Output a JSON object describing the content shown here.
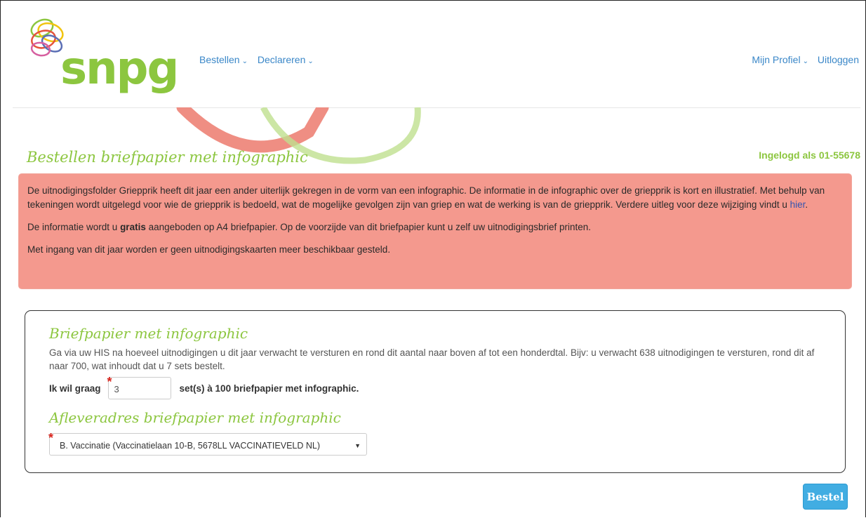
{
  "brand": {
    "name": "snpg",
    "colors": {
      "accent": "#8cc63f",
      "alert": "#f4998e",
      "link": "#3a87c8",
      "button": "#41ade2"
    }
  },
  "nav": {
    "left": [
      {
        "label": "Bestellen",
        "icon": "chevron-down-icon"
      },
      {
        "label": "Declareren",
        "icon": "chevron-down-icon"
      }
    ],
    "right": [
      {
        "label": "Mijn Profiel",
        "icon": "chevron-down-icon"
      },
      {
        "label": "Uitloggen"
      }
    ]
  },
  "page": {
    "title": "Bestellen briefpapier met infographic",
    "login_status": "Ingelogd als 01-55678"
  },
  "alert": {
    "p1_text": "De uitnodigingsfolder Griepprik heeft dit jaar een ander uiterlijk gekregen in de vorm van een infographic. De informatie in de infographic over de griepprik is kort en illustratief. Met behulp van tekeningen wordt uitgelegd voor wie de griepprik is bedoeld, wat de mogelijke gevolgen zijn van griep en wat de werking is van de griepprik. Verdere uitleg voor deze wijziging vindt u ",
    "p1_link": "hier",
    "p1_end": ".",
    "p2_start": "De informatie wordt u ",
    "p2_bold": "gratis",
    "p2_end": " aangeboden op A4 briefpapier. Op de voorzijde van dit briefpapier kunt u zelf uw uitnodigingsbrief printen.",
    "p3": "Met ingang van dit jaar worden er geen uitnodigingskaarten meer beschikbaar gesteld."
  },
  "order": {
    "heading": "Briefpapier met infographic",
    "intro": "Ga via uw HIS na hoeveel uitnodigingen u dit jaar verwacht te versturen en rond dit aantal naar boven af tot een honderdtal. Bijv: u verwacht 638 uitnodigingen te versturen, rond dit af naar 700, wat inhoudt dat u 7 sets bestelt.",
    "qty_label": "Ik wil graag",
    "qty_value": "3",
    "qty_suffix": "set(s) à 100 briefpapier met infographic.",
    "address_heading": "Afleveradres briefpapier met infographic",
    "address_value": "B. Vaccinatie (Vaccinatielaan 10-B, 5678LL VACCINATIEVELD NL)",
    "required_mark": "*",
    "submit_label": "Bestel"
  }
}
